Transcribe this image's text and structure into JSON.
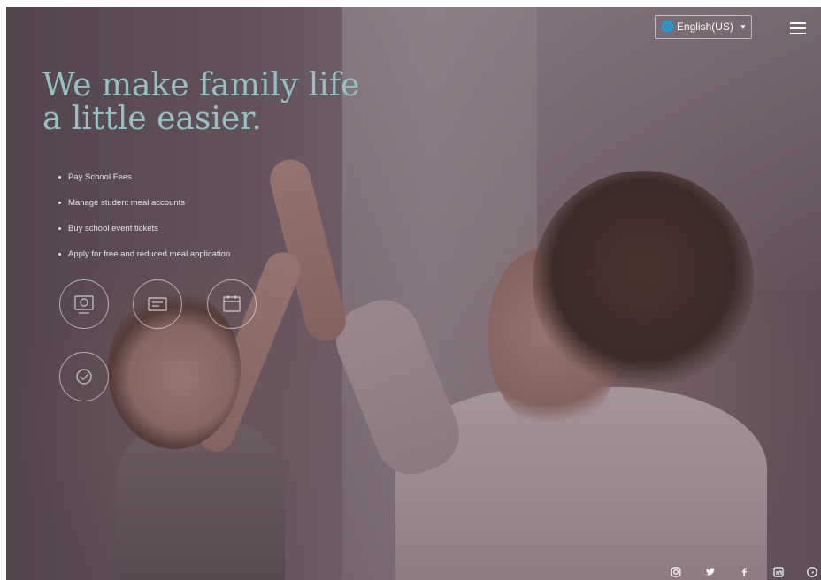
{
  "header": {
    "language_label": "English(US)",
    "globe_icon": "globe-icon",
    "menu_icon": "hamburger-menu-icon"
  },
  "hero": {
    "headline_line1": "We make family life",
    "headline_line2": "a little easier.",
    "features": [
      "Pay School Fees",
      "Manage student meal accounts",
      "Buy school event tickets",
      "Apply for free and reduced meal application"
    ],
    "feature_icons": [
      "school-fees-icon",
      "meal-account-icon",
      "event-tickets-icon",
      "meal-application-icon"
    ]
  },
  "social": {
    "icons": [
      "instagram-icon",
      "twitter-icon",
      "facebook-icon",
      "linkedin-icon",
      "pinterest-icon"
    ]
  },
  "colors": {
    "headline": "#8fc3c6",
    "overlay": "#463741"
  }
}
